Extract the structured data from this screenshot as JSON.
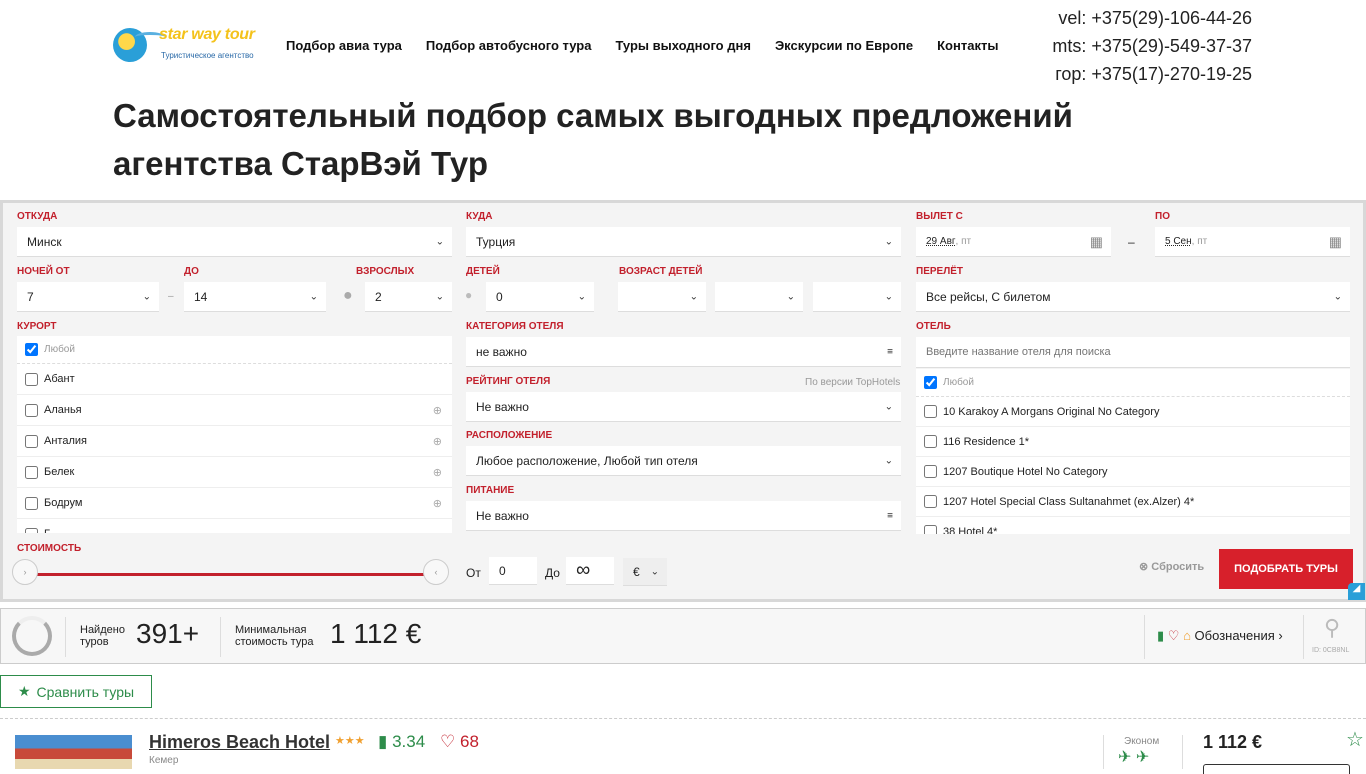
{
  "header": {
    "logo_text": "star way tour",
    "logo_sub": "Туристическое агентство",
    "nav": [
      "Подбор авиа тура",
      "Подбор автобусного тура",
      "Туры выходного дня",
      "Экскурсии по Европе",
      "Контакты"
    ],
    "phones": [
      "vel: +375(29)-106-44-26",
      "mts: +375(29)-549-37-37",
      "гор: +375(17)-270-19-25"
    ]
  },
  "page": {
    "title": "Самостоятельный подбор самых выгодных предложений агентства СтарВэй Тур"
  },
  "form": {
    "from": {
      "label": "ОТКУДА",
      "value": "Минск"
    },
    "to": {
      "label": "КУДА",
      "value": "Турция"
    },
    "depart_from": {
      "label": "ВЫЛЕТ С",
      "date": "29 Авг",
      "day": ", пт"
    },
    "depart_to": {
      "label": "ПО",
      "date": "5 Сен",
      "day": ", пт"
    },
    "dash": "–",
    "nights_from": {
      "label": "НОЧЕЙ ОТ",
      "value": "7"
    },
    "nights_to": {
      "label": "ДО",
      "value": "14"
    },
    "adults": {
      "label": "ВЗРОСЛЫХ",
      "value": "2"
    },
    "children": {
      "label": "ДЕТЕЙ",
      "value": "0"
    },
    "children_age": {
      "label": "ВОЗРАСТ ДЕТЕЙ"
    },
    "flight": {
      "label": "ПЕРЕЛЁТ",
      "value": "Все рейсы, С билетом"
    },
    "resort": {
      "label": "КУРОРТ",
      "items": [
        "Любой",
        "Абант",
        "Аланья",
        "Анталия",
        "Белек",
        "Бодрум",
        "Г"
      ]
    },
    "hotel_category": {
      "label": "КАТЕГОРИЯ ОТЕЛЯ",
      "value": "не важно"
    },
    "hotel_rating": {
      "label": "РЕЙТИНГ ОТЕЛЯ",
      "note": "По версии TopHotels",
      "value": "Не важно"
    },
    "location": {
      "label": "РАСПОЛОЖЕНИЕ",
      "value": "Любое расположение, Любой тип отеля"
    },
    "meal": {
      "label": "ПИТАНИЕ",
      "value": "Не важно"
    },
    "hotel": {
      "label": "ОТЕЛЬ",
      "placeholder": "Введите название отеля для поиска",
      "items": [
        "Любой",
        "10 Karakoy A Morgans Original No Category",
        "116 Residence 1*",
        "1207 Boutique Hotel No Category",
        "1207 Hotel Special Class Sultanahmet (ex.Alzer) 4*",
        "38 Hotel 4*"
      ]
    },
    "price": {
      "label": "СТОИМОСТЬ",
      "from_label": "От",
      "from_value": "0",
      "to_label": "До",
      "to_value": "∞",
      "currency": "€"
    },
    "reset": "Сбросить",
    "submit": "ПОДОБРАТЬ ТУРЫ"
  },
  "stats": {
    "found_label": "Найдено туров",
    "found_value": "391+",
    "min_label": "Минимальная стоимость тура",
    "min_value": "1 112 €",
    "legend": "Обозначения",
    "id": "ID: 0CB8NL"
  },
  "compare_button": "Сравнить туры",
  "result": {
    "name": "Himeros Beach Hotel",
    "rating": "3.34",
    "likes": "68",
    "location": "Кемер",
    "flight_class": "Эконом",
    "price": "1 112 €"
  },
  "colors": {
    "accent": "#c2202c",
    "green": "#2d8c4a"
  }
}
